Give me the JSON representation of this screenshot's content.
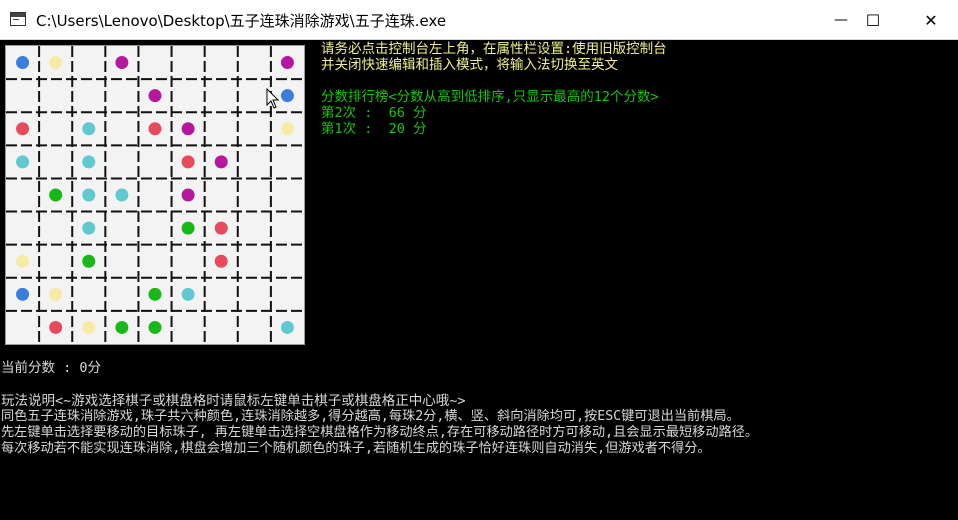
{
  "window": {
    "title": "C:\\Users\\Lenovo\\Desktop\\五子连珠消除游戏\\五子连珠.exe",
    "minimize_glyph": "—",
    "maximize_glyph": "☐",
    "close_glyph": "✕"
  },
  "colors": {
    "blue": "#3b7ddd",
    "yellow": "#f5eba4",
    "purple": "#b5179e",
    "red": "#e54b5b",
    "cyan": "#5fc9cf",
    "green": "#17b817"
  },
  "board": {
    "rows": 9,
    "cols": 9,
    "pieces": [
      {
        "row": 0,
        "col": 0,
        "color": "blue"
      },
      {
        "row": 0,
        "col": 1,
        "color": "yellow"
      },
      {
        "row": 0,
        "col": 3,
        "color": "purple"
      },
      {
        "row": 0,
        "col": 8,
        "color": "purple"
      },
      {
        "row": 1,
        "col": 4,
        "color": "purple"
      },
      {
        "row": 1,
        "col": 8,
        "color": "blue"
      },
      {
        "row": 2,
        "col": 0,
        "color": "red"
      },
      {
        "row": 2,
        "col": 2,
        "color": "cyan"
      },
      {
        "row": 2,
        "col": 4,
        "color": "red"
      },
      {
        "row": 2,
        "col": 5,
        "color": "purple"
      },
      {
        "row": 2,
        "col": 8,
        "color": "yellow"
      },
      {
        "row": 3,
        "col": 0,
        "color": "cyan"
      },
      {
        "row": 3,
        "col": 2,
        "color": "cyan"
      },
      {
        "row": 3,
        "col": 5,
        "color": "red"
      },
      {
        "row": 3,
        "col": 6,
        "color": "purple"
      },
      {
        "row": 4,
        "col": 1,
        "color": "green"
      },
      {
        "row": 4,
        "col": 2,
        "color": "cyan"
      },
      {
        "row": 4,
        "col": 3,
        "color": "cyan"
      },
      {
        "row": 4,
        "col": 5,
        "color": "purple"
      },
      {
        "row": 5,
        "col": 2,
        "color": "cyan"
      },
      {
        "row": 5,
        "col": 5,
        "color": "green"
      },
      {
        "row": 5,
        "col": 6,
        "color": "red"
      },
      {
        "row": 6,
        "col": 0,
        "color": "yellow"
      },
      {
        "row": 6,
        "col": 2,
        "color": "green"
      },
      {
        "row": 6,
        "col": 6,
        "color": "red"
      },
      {
        "row": 7,
        "col": 0,
        "color": "blue"
      },
      {
        "row": 7,
        "col": 1,
        "color": "yellow"
      },
      {
        "row": 7,
        "col": 4,
        "color": "green"
      },
      {
        "row": 7,
        "col": 5,
        "color": "cyan"
      },
      {
        "row": 8,
        "col": 1,
        "color": "red"
      },
      {
        "row": 8,
        "col": 2,
        "color": "yellow"
      },
      {
        "row": 8,
        "col": 3,
        "color": "green"
      },
      {
        "row": 8,
        "col": 4,
        "color": "green"
      },
      {
        "row": 8,
        "col": 8,
        "color": "cyan"
      }
    ]
  },
  "notice": {
    "line1": "请务必点击控制台左上角，在属性栏设置:使用旧版控制台",
    "line2": "并关闭快速编辑和插入模式，将输入法切换至英文"
  },
  "leaderboard": {
    "title": "分数排行榜<分数从高到低排序,只显示最高的12个分数>",
    "entries": [
      "第2次 :  66 分",
      "第1次 :  20 分"
    ]
  },
  "score": {
    "text": "当前分数 : 0分"
  },
  "instructions": {
    "title": "玩法说明<~游戏选择棋子或棋盘格时请鼠标左键单击棋子或棋盘格正中心哦~>",
    "lines": [
      "同色五子连珠消除游戏,珠子共六种颜色,连珠消除越多,得分越高,每珠2分,横、竖、斜向消除均可,按ESC键可退出当前棋局。",
      "先左键单击选择要移动的目标珠子, 再左键单击选择空棋盘格作为移动终点,存在可移动路径时方可移动,且会显示最短移动路径。",
      "每次移动若不能实现连珠消除,棋盘会增加三个随机颜色的珠子,若随机生成的珠子恰好连珠则自动消失,但游戏者不得分。"
    ]
  }
}
